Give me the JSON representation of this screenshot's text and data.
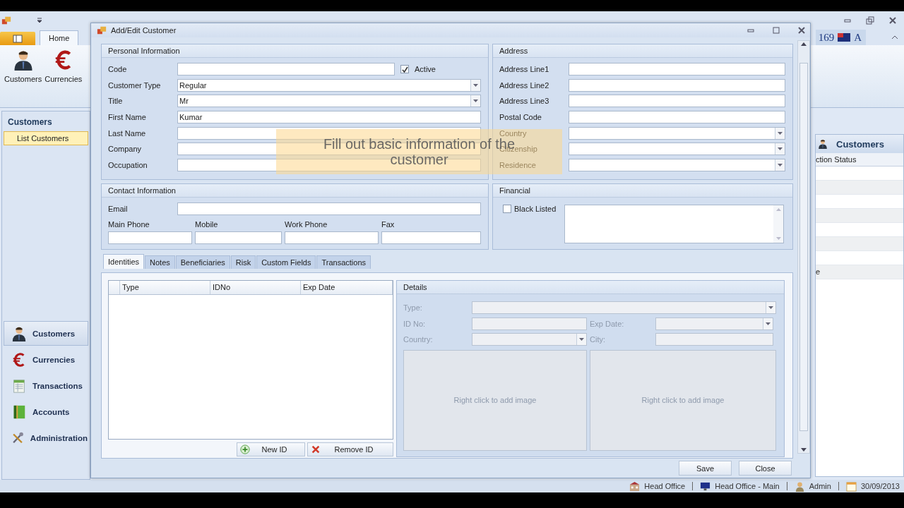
{
  "ribbon": {
    "tabs": [
      {
        "label": "Home",
        "selected": true
      }
    ],
    "buttons": [
      {
        "label": "Customers"
      },
      {
        "label": "Currencies"
      }
    ]
  },
  "top_right": {
    "number": "169",
    "letter": "A"
  },
  "nav_pane": {
    "title": "Customers",
    "items": [
      {
        "label": "List Customers",
        "selected": true
      }
    ]
  },
  "nav_sections": [
    {
      "label": "Customers",
      "selected": true
    },
    {
      "label": "Currencies",
      "selected": false
    },
    {
      "label": "Transactions",
      "selected": false
    },
    {
      "label": "Accounts",
      "selected": false
    },
    {
      "label": "Administration",
      "selected": false
    }
  ],
  "right_panel": {
    "title": "Customers",
    "column_header": "ction Status",
    "cell": "e"
  },
  "status_bar": [
    "Head Office",
    "Head Office - Main",
    "Admin",
    "30/09/2013"
  ],
  "dialog": {
    "title": "Add/Edit Customer",
    "personal": {
      "title": "Personal Information",
      "fields": [
        {
          "label": "Code",
          "kind": "text",
          "checkbox": {
            "label": "Active",
            "checked": true
          }
        },
        {
          "label": "Customer Type",
          "kind": "combo",
          "value": "Regular"
        },
        {
          "label": "Title",
          "kind": "combo",
          "value": "Mr"
        },
        {
          "label": "First Name",
          "kind": "text",
          "value": "Kumar"
        },
        {
          "label": "Last Name",
          "kind": "text"
        },
        {
          "label": "Company",
          "kind": "text"
        },
        {
          "label": "Occupation",
          "kind": "text"
        }
      ]
    },
    "address": {
      "title": "Address",
      "fields": [
        {
          "label": "Address Line1",
          "kind": "text"
        },
        {
          "label": "Address Line2",
          "kind": "text"
        },
        {
          "label": "Address Line3",
          "kind": "text"
        },
        {
          "label": "Postal Code",
          "kind": "text"
        },
        {
          "label": "Country",
          "kind": "combo"
        },
        {
          "label": "Citizenship",
          "kind": "combo"
        },
        {
          "label": "Residence",
          "kind": "combo"
        }
      ]
    },
    "contact": {
      "title": "Contact Information",
      "email_label": "Email",
      "phones": [
        "Main Phone",
        "Mobile",
        "Work Phone",
        "Fax"
      ]
    },
    "financial": {
      "title": "Financial",
      "checkbox": {
        "label": "Black Listed",
        "checked": false
      }
    },
    "tabs": [
      {
        "label": "Identities",
        "selected": true
      },
      {
        "label": "Notes",
        "selected": false
      },
      {
        "label": "Beneficiaries",
        "selected": false
      },
      {
        "label": "Risk",
        "selected": false
      },
      {
        "label": "Custom Fields",
        "selected": false
      },
      {
        "label": "Transactions",
        "selected": false
      }
    ],
    "grid_columns": [
      "Type",
      "IDNo",
      "Exp Date"
    ],
    "grid_buttons": [
      "New ID",
      "Remove ID"
    ],
    "details": {
      "title": "Details",
      "disabled": true,
      "type_label": "Type:",
      "id_label": "ID No:",
      "exp_label": "Exp Date:",
      "country_label": "Country:",
      "city_label": "City:",
      "images": [
        "Right click to add image",
        "Right click to add image"
      ]
    },
    "buttons": [
      "Save",
      "Close"
    ],
    "hint": "Fill out basic information of the customer"
  }
}
